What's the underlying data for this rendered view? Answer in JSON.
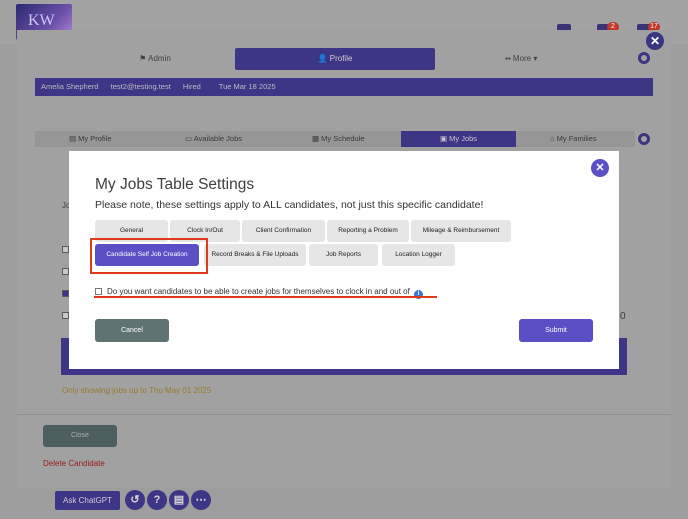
{
  "background": {
    "logo_text": "KW",
    "badges": [
      "2",
      "17"
    ],
    "top_tabs": {
      "admin": "Admin",
      "profile": "Profile",
      "more": "More"
    },
    "candidate": {
      "name": "Amelia Shepherd",
      "email": "test2@testing.test",
      "status": "Hired",
      "date": "Tue Mar 18 2025"
    },
    "sub_tabs": {
      "my_profile": "My Profile",
      "available_jobs": "Available Jobs",
      "my_schedule": "My Schedule",
      "my_jobs": "My Jobs",
      "my_families": "My Families"
    },
    "partial_label": "Jo",
    "partial_value": "0",
    "showing_note": "Only showing jobs up to Thu May 01 2025",
    "close_label": "Close",
    "delete_label": "Delete Candidate",
    "ask_label": "Ask ChatGPT"
  },
  "modal": {
    "close_glyph": "✕",
    "title": "My Jobs Table Settings",
    "note": "Please note, these settings apply to ALL candidates, not just this specific candidate!",
    "tabs": [
      "General",
      "Clock In/Out",
      "Client Confirmation",
      "Reporting a Problem",
      "Mileage & Reimbursement",
      "Candidate Self Job Creation",
      "Record Breaks & File Uploads",
      "Job Reports",
      "Location Logger"
    ],
    "active_tab": "Candidate Self Job Creation",
    "question": "Do you want candidates to be able to create jobs for themselves to clock in and out of",
    "info_glyph": "i",
    "cancel_label": "Cancel",
    "submit_label": "Submit"
  },
  "colors": {
    "accent": "#5b4fc6",
    "annotation": "#e03a1e",
    "cancel": "#5f7373"
  }
}
